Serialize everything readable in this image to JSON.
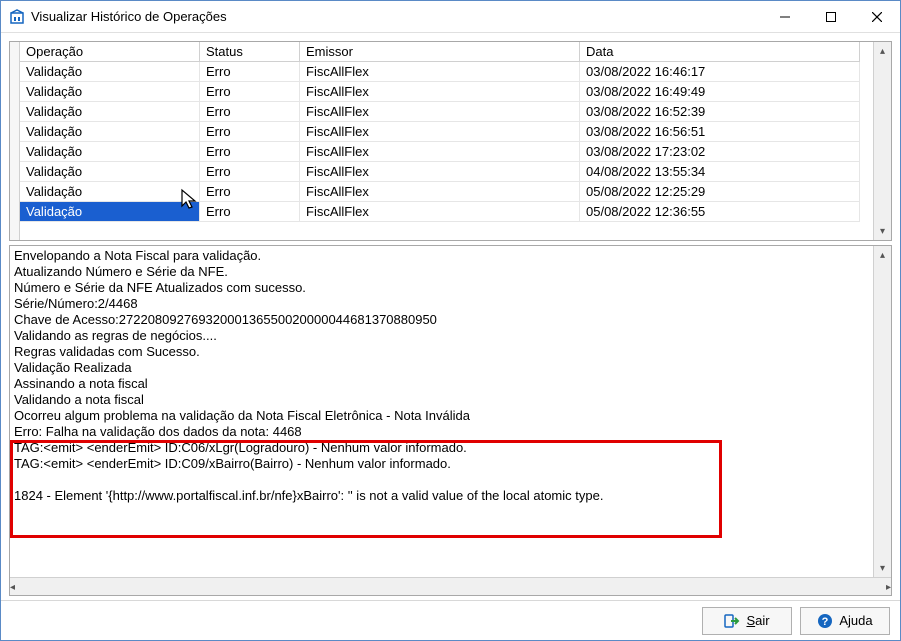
{
  "window": {
    "title": "Visualizar Histórico de Operações"
  },
  "grid": {
    "headers": {
      "op": "Operação",
      "status": "Status",
      "emissor": "Emissor",
      "data": "Data"
    },
    "rows": [
      {
        "op": "Validação",
        "status": "Erro",
        "emissor": "FiscAllFlex",
        "data": "03/08/2022 16:46:17"
      },
      {
        "op": "Validação",
        "status": "Erro",
        "emissor": "FiscAllFlex",
        "data": "03/08/2022 16:49:49"
      },
      {
        "op": "Validação",
        "status": "Erro",
        "emissor": "FiscAllFlex",
        "data": "03/08/2022 16:52:39"
      },
      {
        "op": "Validação",
        "status": "Erro",
        "emissor": "FiscAllFlex",
        "data": "03/08/2022 16:56:51"
      },
      {
        "op": "Validação",
        "status": "Erro",
        "emissor": "FiscAllFlex",
        "data": "03/08/2022 17:23:02"
      },
      {
        "op": "Validação",
        "status": "Erro",
        "emissor": "FiscAllFlex",
        "data": "04/08/2022 13:55:34"
      },
      {
        "op": "Validação",
        "status": "Erro",
        "emissor": "FiscAllFlex",
        "data": "05/08/2022 12:25:29"
      },
      {
        "op": "Validação",
        "status": "Erro",
        "emissor": "FiscAllFlex",
        "data": "05/08/2022 12:36:55"
      }
    ],
    "selected_index": 7
  },
  "log": {
    "lines": [
      "Envelopando a Nota Fiscal para validação.",
      "Atualizando Número e Série da NFE.",
      "Número e Série da NFE Atualizados com sucesso.",
      "Série/Número:2/4468",
      "Chave de Acesso:27220809276932000136550020000044681370880950",
      "Validando as regras de negócios....",
      "Regras validadas com Sucesso.",
      "Validação Realizada",
      "Assinando a nota fiscal",
      "Validando a nota fiscal",
      "Ocorreu algum problema na validação da Nota Fiscal Eletrônica - Nota Inválida",
      "Erro: Falha na validação dos dados da nota: 4468",
      "TAG:<emit> <enderEmit>  ID:C06/xLgr(Logradouro) - Nenhum valor informado.",
      "TAG:<emit> <enderEmit>  ID:C09/xBairro(Bairro) - Nenhum valor informado.",
      "",
      "1824 - Element '{http://www.portalfiscal.inf.br/nfe}xBairro': '' is not a valid value of the local atomic type."
    ]
  },
  "footer": {
    "sair": "Sair",
    "ajuda": "Ajuda"
  }
}
